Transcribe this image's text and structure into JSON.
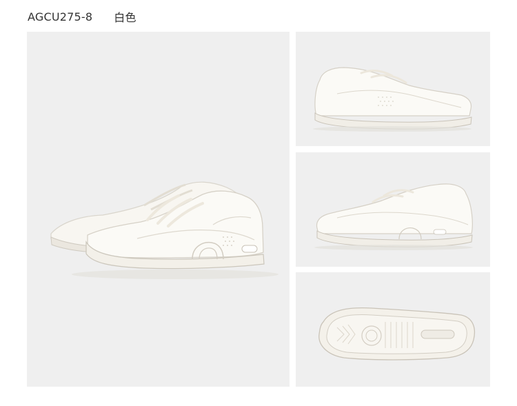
{
  "product": {
    "model_code": "AGCU275-8",
    "color_name": "白色"
  },
  "gallery": {
    "images": [
      {
        "view": "pair-three-quarter-view",
        "icon": "sneaker-pair-image"
      },
      {
        "view": "side-profile-lateral",
        "icon": "sneaker-side-image"
      },
      {
        "view": "side-profile-medial",
        "icon": "sneaker-side-image"
      },
      {
        "view": "outsole-bottom",
        "icon": "sneaker-sole-image"
      }
    ]
  },
  "colors": {
    "panel_background": "#efefef",
    "shoe_white": "#f7f5f0",
    "shoe_shadow": "#ddd9d2",
    "text": "#333333"
  }
}
